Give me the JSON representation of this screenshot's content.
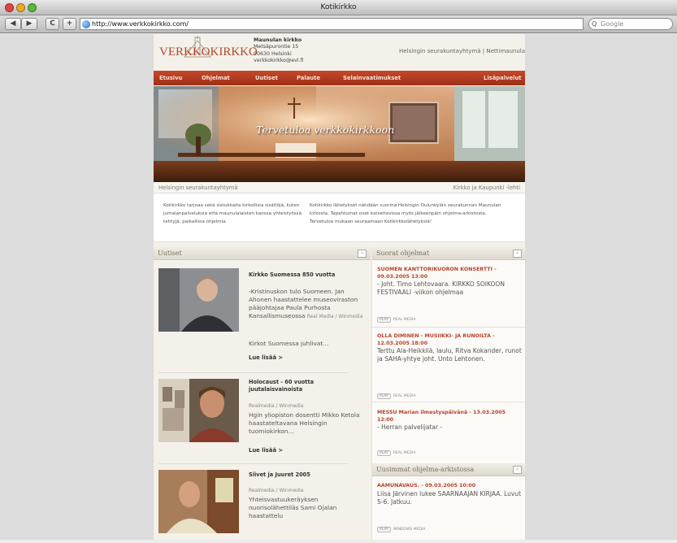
{
  "browser": {
    "title": "Kotikirkko",
    "url": "http://www.verkkokirkko.com/",
    "search_placeholder": "Google",
    "back_label": "◀",
    "forward_label": "▶",
    "reload_label": "C",
    "add_label": "+"
  },
  "header": {
    "logo_text": "VERKKOKIRKKO",
    "address_name": "Maunulan kirkko",
    "address_street": "Metsäpurontie 15",
    "address_city": "00630 Helsinki",
    "address_email": "verkkokirkko@evl.fi",
    "link_1": "Helsingin seurakuntayhtymä",
    "link_separator": "|",
    "link_2": "Nettimaunula"
  },
  "nav": {
    "items": [
      "Etusivu",
      "Ohjelmat",
      "Uutiset",
      "Palaute",
      "Selainvaatimukset"
    ],
    "right_item": "Lisäpalvelut"
  },
  "hero": {
    "caption": "Tervetuloa verkkokirkkoon"
  },
  "subbar": {
    "left": "Helsingin seurakuntayhtymä",
    "right": "Kirkko ja Kaupunki -lehti"
  },
  "intro": {
    "left": "Kotikirkko tarjoaa sekä sielukkaita kirkollisia sisältöjä, kuten jumalanpalveluksia että maunulalaisten kanssa yhteistyössä tehtyjä, paikallisia ohjelmia.",
    "right": "Kotikirkko lähetykset nähdään suorina Helsingin Oulunkylän seurakunnan Maunulan kirkosta. Tapahtumat ovat katseltavissa myös jälkeenpäin ohjelma-arkistosta. Tervetuloa mukaan seuraamaan Kotikirkkolähetyksiä!"
  },
  "uutiset": {
    "header": "Uutiset",
    "items": [
      {
        "title": "Kirkko Suomessa 850 vuotta",
        "body": "-Kristinuskon tulo Suomeen. Jan Ahonen haastattelee museoviraston pääjohtajaa Paula Purhosta Kansallismuseossa",
        "meta": "Real Media / Winmedia",
        "extra": "Kirkot Suomessa juhlivat...",
        "more": "Lue lisää >"
      },
      {
        "title": "Holocaust - 60 vuotta juutalaisvainoista",
        "meta": "Realmedia / Winmedia",
        "body": "Hgin yliopiston dosentti Mikko Ketola haastateltavana Helsingin tuomiokirkon...",
        "more": "Lue lisää >"
      },
      {
        "title": "Siivet ja Juuret 2005",
        "meta": "Realmedia / Winmedia",
        "body": "Yhteisvastuukeräyksen nuorisolähettiläs Sami Ojalan haastattelu"
      }
    ]
  },
  "suorat": {
    "header": "Suorat ohjelmat",
    "items": [
      {
        "title": "SUOMEN KANTTORIKUORON KONSERTTI - 09.03.2005 13:00",
        "body": "- Joht. Timo Lehtovaara. KIRKKO SOIKOON FESTIVAALI -viikon ohjelmaa",
        "play": "PLAY",
        "media": "REAL MEDIA"
      },
      {
        "title": "OLLA DIMINEN - MUSIIKKI- JA RUNOILTA - 12.03.2005 18:00",
        "body": "Terttu Ala-Heikkilä, laulu, Ritva Kokander, runot ja SAHA-yhtye joht. Unto Lehtonen.",
        "play": "PLAY",
        "media": "REAL MEDIA"
      },
      {
        "title": "MESSU Marian ilmestyspäivänä - 13.03.2005 12:00",
        "body": "- Herran palvelijatar -",
        "play": "PLAY",
        "media": "REAL MEDIA"
      }
    ]
  },
  "arkisto": {
    "header": "Uusimmat ohjelma-arkistossa",
    "items": [
      {
        "title": "AAMUNAVAUS. - 09.03.2005 10:00",
        "body": "Liisa Järvinen lukee SAARNAAJAN KIRJAA. Luvut 5-6. Jatkuu.",
        "play": "PLAY",
        "media": "WINDOWS MEDIA"
      }
    ]
  },
  "icons": {
    "arrow": "»"
  }
}
